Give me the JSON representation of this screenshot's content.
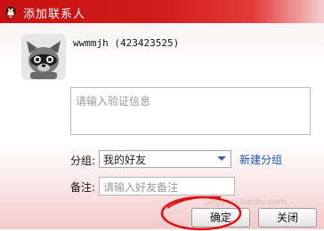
{
  "window": {
    "title": "添加联系人",
    "title_icon": "qq-penguin-icon"
  },
  "contact": {
    "avatar": "raccoon-avatar",
    "user_line": "wwmmjh (423423525)"
  },
  "verify": {
    "placeholder": "请输入验证信息"
  },
  "group": {
    "label": "分组:",
    "selected": "我的好友",
    "new_group_link": "新建分组"
  },
  "remark": {
    "label": "备注:",
    "placeholder": "请输入好友备注"
  },
  "buttons": {
    "ok": "确定",
    "close": "关闭"
  },
  "watermark": "jingyan.baidu.com",
  "colors": {
    "titlebar": "#c81010",
    "link": "#1a55b8",
    "annotation": "#e01010"
  }
}
